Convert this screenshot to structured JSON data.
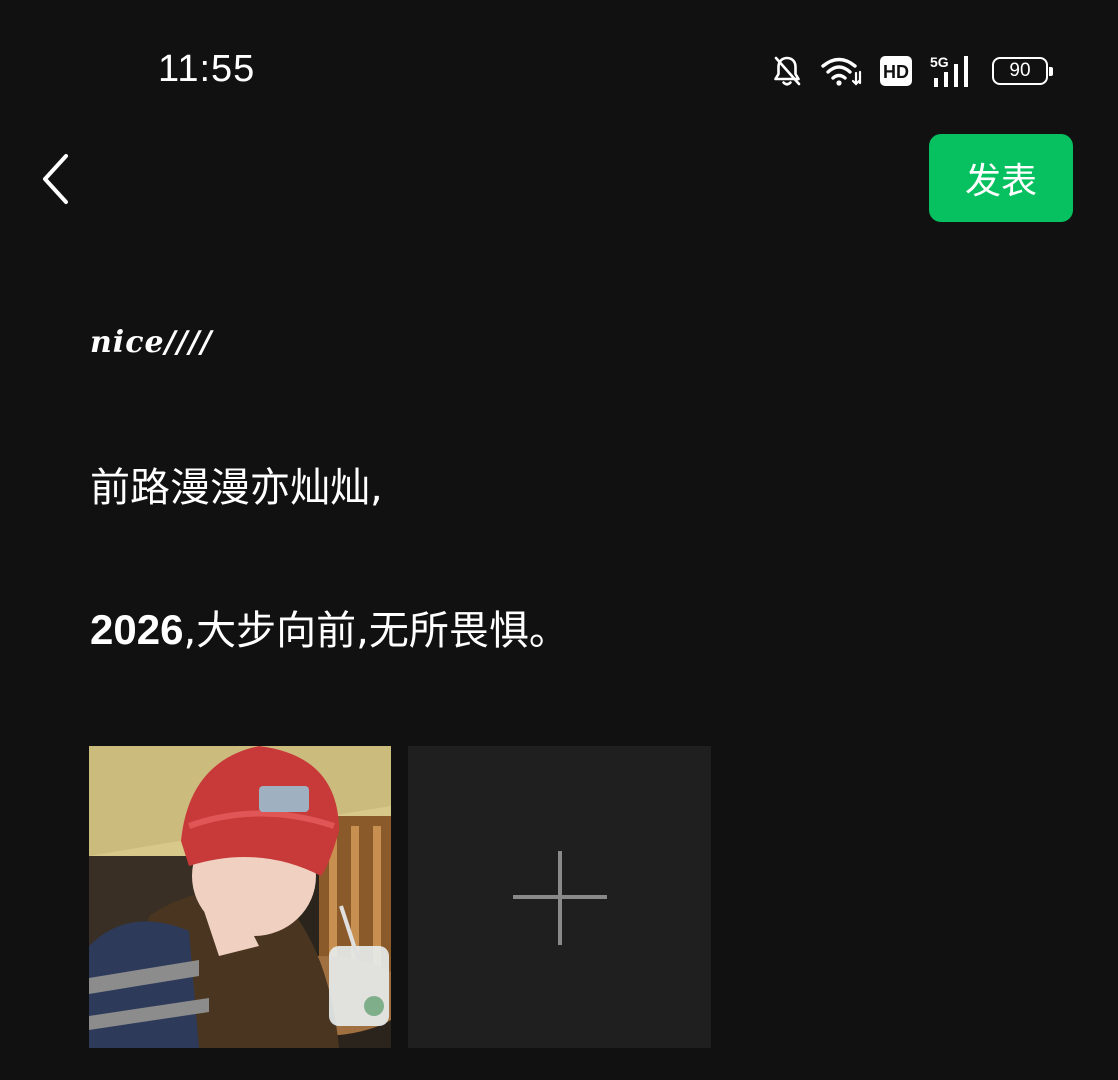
{
  "status_bar": {
    "time": "11:55",
    "icons": [
      "bell-off-icon",
      "wifi-icon",
      "hd-icon",
      "signal-5g-icon",
      "battery-icon"
    ],
    "hd_label": "HD",
    "network_label": "5G",
    "battery_level": "90"
  },
  "header": {
    "back_icon": "chevron-left-icon",
    "publish_label": "发表",
    "publish_color": "#07c160"
  },
  "post": {
    "decor_text": "nice////",
    "line1": "前路漫漫亦灿灿,",
    "line2_year": "2026",
    "line2_rest": ",大步向前,无所畏惧。"
  },
  "media": {
    "photos_count": 1,
    "add_icon": "plus-icon"
  },
  "colors": {
    "background": "#111111",
    "text": "#ffffff",
    "tile": "#1f1f1f",
    "plus": "#8a8a8a"
  }
}
